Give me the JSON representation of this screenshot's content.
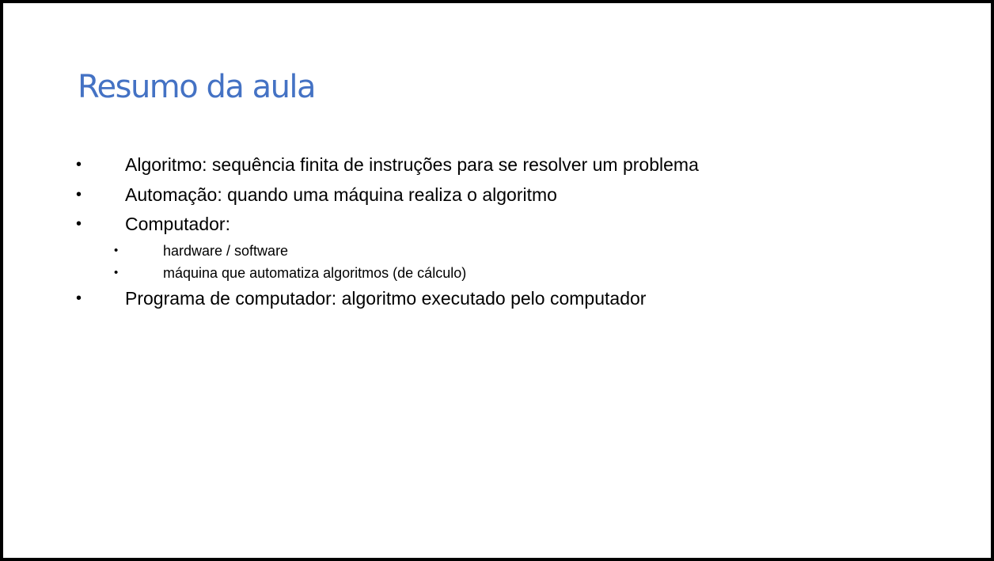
{
  "slide": {
    "title": "Resumo da aula",
    "title_color": "#4472c4",
    "bullet_char": "•",
    "items": [
      {
        "level": 1,
        "text": "Algoritmo: sequência finita de instruções para se resolver um problema"
      },
      {
        "level": 1,
        "text": "Automação: quando uma máquina realiza o algoritmo"
      },
      {
        "level": 1,
        "text": "Computador:"
      },
      {
        "level": 2,
        "text": "hardware / software"
      },
      {
        "level": 2,
        "text": "máquina que automatiza algoritmos (de cálculo)"
      },
      {
        "level": 1,
        "text": "Programa de computador: algoritmo executado pelo computador"
      }
    ]
  }
}
